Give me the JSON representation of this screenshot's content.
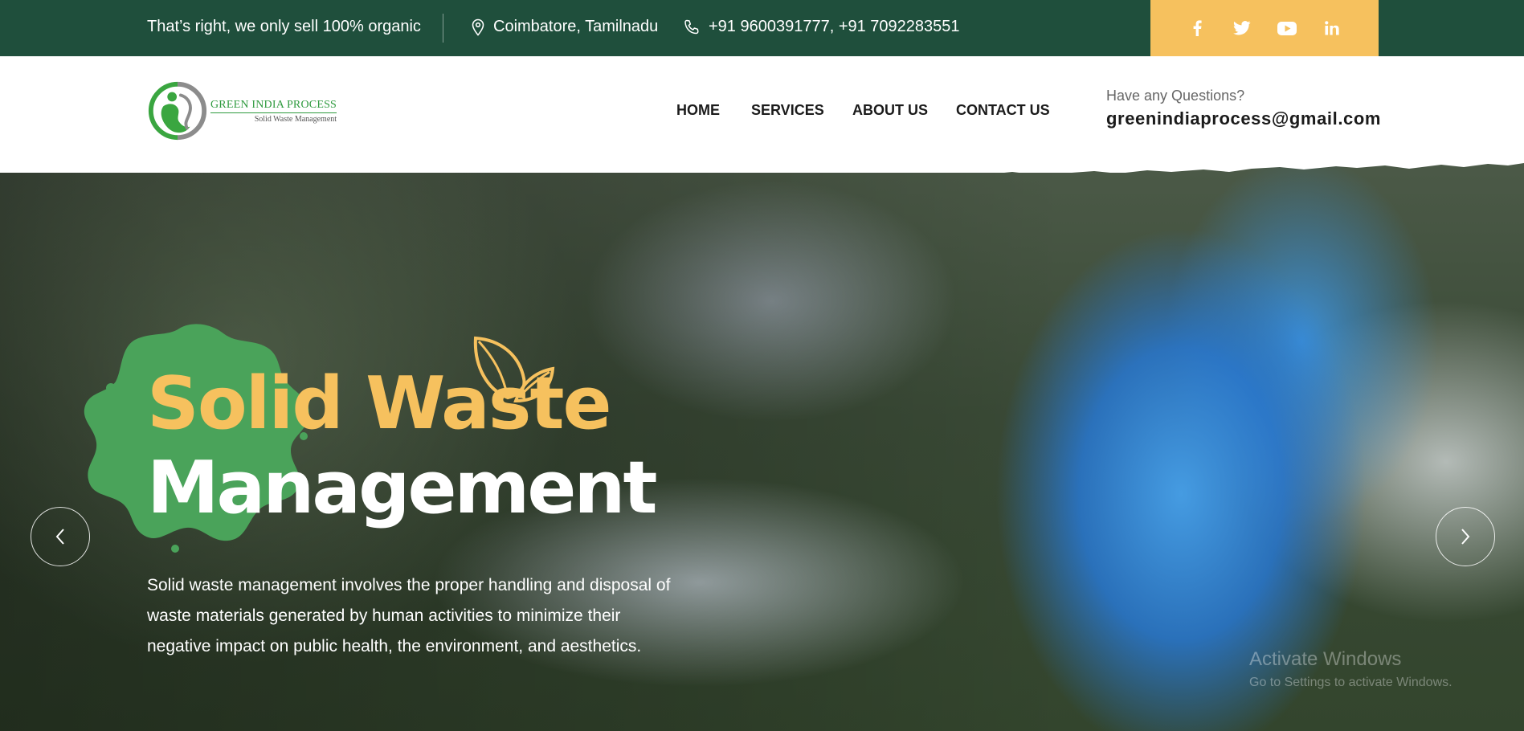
{
  "topbar": {
    "tagline": "That’s right, we only sell 100% organic",
    "location": "Coimbatore, Tamilnadu",
    "phone": "+91 9600391777, +91 7092283551",
    "location_icon": "map-pin-icon",
    "phone_icon": "phone-icon",
    "social": [
      "facebook-icon",
      "twitter-icon",
      "youtube-icon",
      "linkedin-icon"
    ]
  },
  "header": {
    "logo": {
      "brand": "GREEN INDIA PROCESS",
      "sub": "Solid Waste Management"
    },
    "nav": [
      "HOME",
      "SERVICES",
      "ABOUT US",
      "CONTACT US"
    ],
    "questions_label": "Have any Questions?",
    "email": "greenindiaprocess@gmail.com"
  },
  "hero": {
    "title_line1": "Solid Waste",
    "title_line2": "Management",
    "description": "Solid waste management involves the proper handling and disposal of waste materials generated by human activities to minimize their negative impact on public health, the environment, and aesthetics.",
    "prev_icon": "chevron-left-icon",
    "next_icon": "chevron-right-icon"
  },
  "watermark": {
    "line1": "Activate Windows",
    "line2": "Go to Settings to activate Windows."
  },
  "colors": {
    "topbar_bg": "#1f4f3c",
    "social_bg": "#f6c15e",
    "accent_yellow": "#f6c15e",
    "splash_green": "#4aa35a",
    "text_dark": "#1b1b1b"
  }
}
